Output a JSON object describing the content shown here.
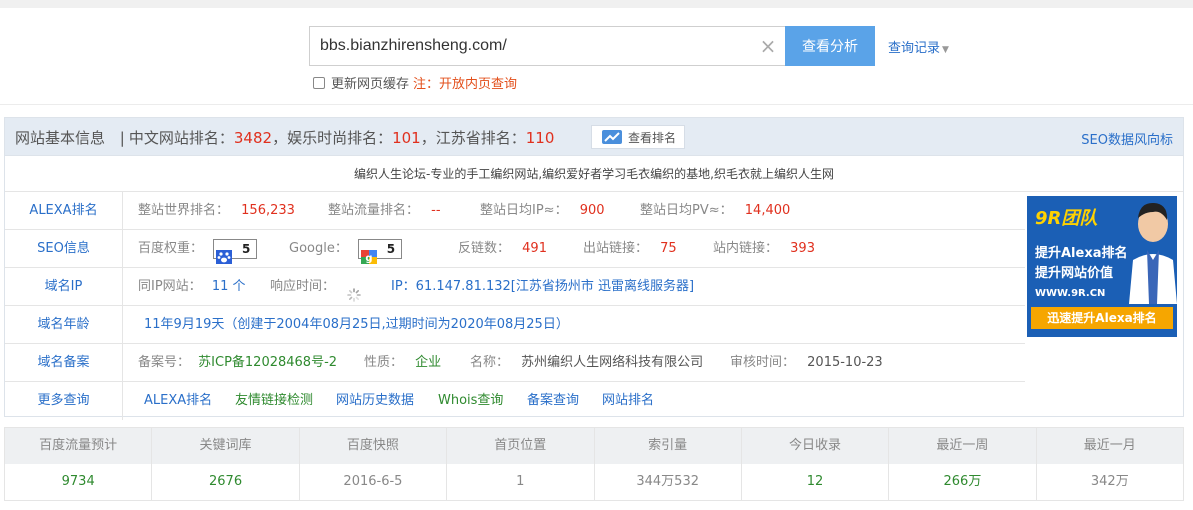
{
  "search": {
    "value": "bbs.bianzhirensheng.com/",
    "clear_icon": "×",
    "button_label": "查看分析",
    "history_label": "查询记录",
    "cache_label": "更新网页缓存",
    "cache_note": "注：开放内页查询"
  },
  "header": {
    "title": "网站基本信息",
    "sep": "|",
    "cn_rank_label": "中文网站排名：",
    "cn_rank": "3482",
    "cat_rank_label": "，娱乐时尚排名：",
    "cat_rank": "101",
    "prov_rank_label": "，江苏省排名：",
    "prov_rank": "110",
    "rank_button": "查看排名",
    "seo_link": "SEO数据风向标"
  },
  "description": "编织人生论坛-专业的手工编织网站,编织爱好者学习毛衣编织的基地,织毛衣就上编织人生网",
  "alexa": {
    "label": "ALEXA排名",
    "world_label": "整站世界排名：",
    "world": "156,233",
    "traffic_label": "整站流量排名：",
    "traffic": "--",
    "ip_label": "整站日均IP≈：",
    "ip": "900",
    "pv_label": "整站日均PV≈：",
    "pv": "14,400"
  },
  "seo": {
    "label": "SEO信息",
    "baidu_label": "百度权重：",
    "baidu": "5",
    "google_label": "Google：",
    "google": "5",
    "backlinks_label": "反链数：",
    "backlinks": "491",
    "outlinks_label": "出站链接：",
    "outlinks": "75",
    "inlinks_label": "站内链接：",
    "inlinks": "393"
  },
  "ip": {
    "label": "域名IP",
    "same_ip_label": "同IP网站：",
    "same_ip": "11 个",
    "response_label": "响应时间：",
    "ip_text": "IP：61.147.81.132[江苏省扬州市 迅雷离线服务器]"
  },
  "age": {
    "label": "域名年龄",
    "text": "11年9月19天（创建于2004年08月25日,过期时间为2020年08月25日）"
  },
  "icp": {
    "label": "域名备案",
    "no_label": "备案号：",
    "no": "苏ICP备12028468号-2",
    "nature_label": "性质：",
    "nature": "企业",
    "name_label": "名称：",
    "name": "苏州编织人生网络科技有限公司",
    "time_label": "审核时间：",
    "time": "2015-10-23"
  },
  "more": {
    "label": "更多查询",
    "links": [
      "ALEXA排名",
      "友情链接检测",
      "网站历史数据",
      "Whois查询",
      "备案查询",
      "网站排名"
    ]
  },
  "ad": {
    "title": "9R团队",
    "line1": "提升Alexa排名",
    "line2": "提升网站价值",
    "url": "WWW.9R.CN",
    "cta": "迅速提升Alexa排名"
  },
  "stats": {
    "headers": [
      "百度流量预计",
      "关键词库",
      "百度快照",
      "首页位置",
      "索引量",
      "今日收录",
      "最近一周",
      "最近一月"
    ],
    "values": [
      "9734",
      "2676",
      "2016-6-5",
      "1",
      "344万532",
      "12",
      "266万",
      "342万"
    ]
  }
}
